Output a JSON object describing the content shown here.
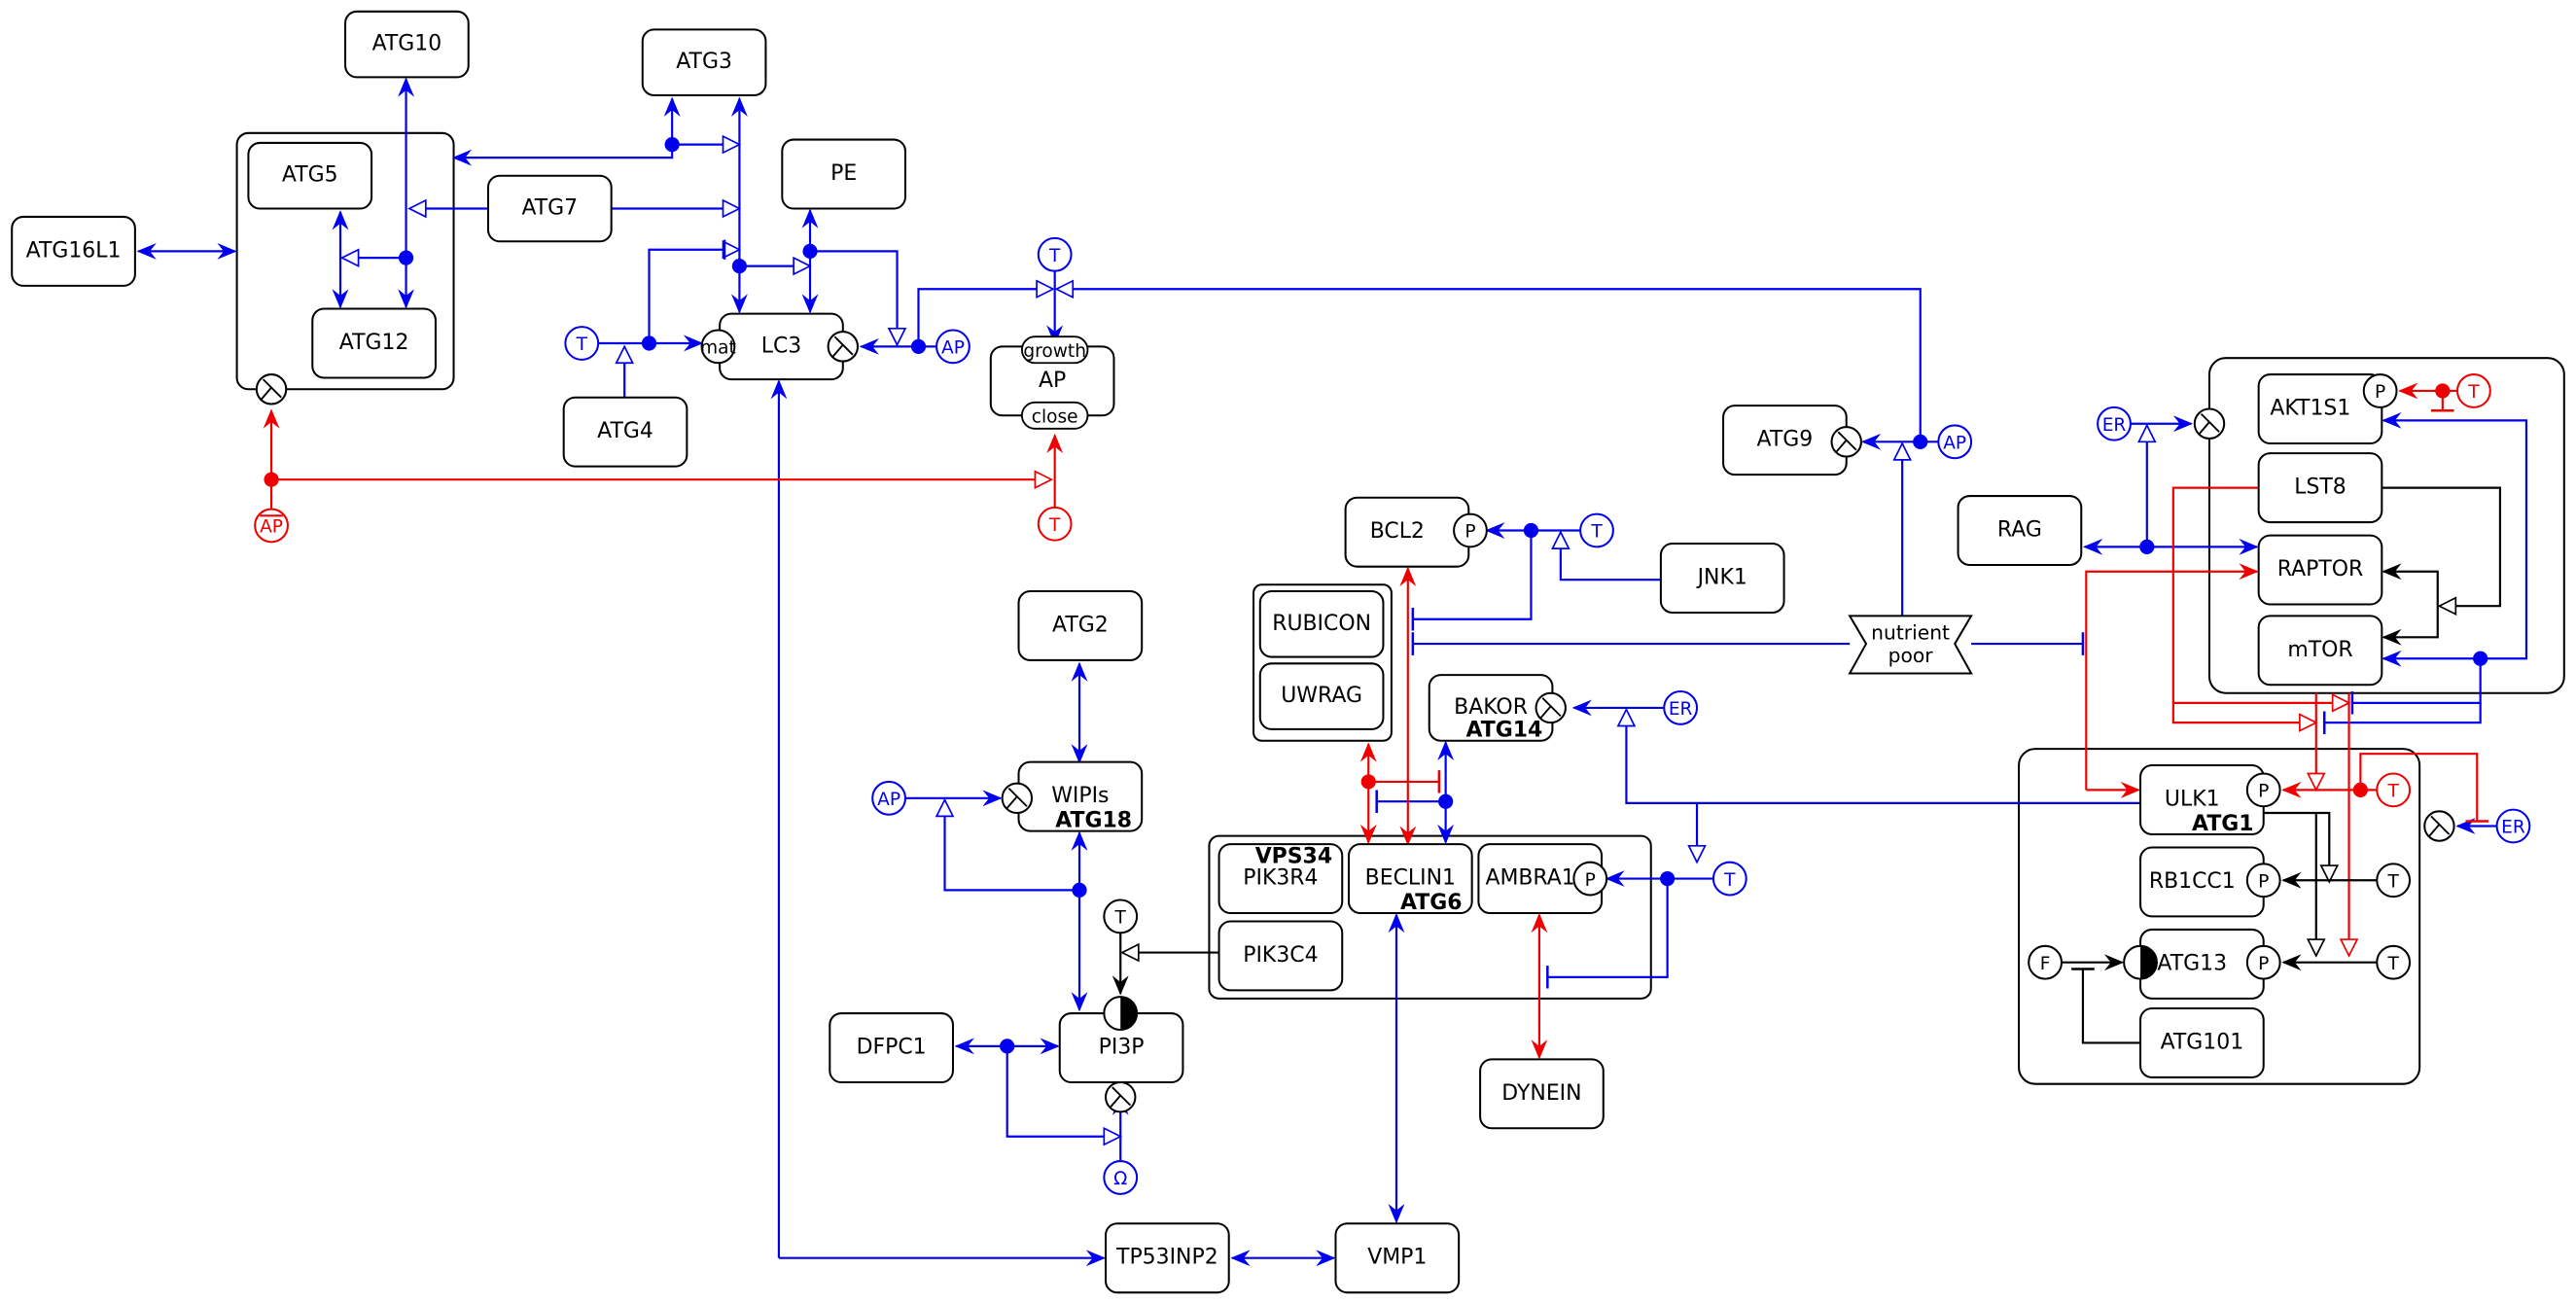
{
  "nodes": {
    "atg10": "ATG10",
    "atg3": "ATG3",
    "atg5": "ATG5",
    "atg12": "ATG12",
    "atg7": "ATG7",
    "atg16l1": "ATG16L1",
    "pe": "PE",
    "lc3": "LC3",
    "atg4": "ATG4",
    "ap": "AP",
    "atg9": "ATG9",
    "bcl2": "BCL2",
    "jnk1": "JNK1",
    "rubicon": "RUBICON",
    "uwrag": "UWRAG",
    "nutrient_poor_1": "nutrient",
    "nutrient_poor_2": "poor",
    "bakor": "BAKOR",
    "atg2": "ATG2",
    "wipis": "WIPIs",
    "pik3r4": "PIK3R4",
    "beclin1": "BECLIN1",
    "ambra1": "AMBRA1",
    "pik3c4": "PIK3C4",
    "pi3p": "PI3P",
    "dfpc1": "DFPC1",
    "dynein": "DYNEIN",
    "tp53inp2": "TP53INP2",
    "vmp1": "VMP1",
    "rag": "RAG",
    "akt1s1": "AKT1S1",
    "lst8": "LST8",
    "raptor": "RAPTOR",
    "mtor": "mTOR",
    "ulk1": "ULK1",
    "rb1cc1": "RB1CC1",
    "atg13": "ATG13",
    "atg101": "ATG101"
  },
  "aliases": {
    "bakor": "ATG14",
    "wipis": "ATG18",
    "pik3r4": "VPS34",
    "beclin1": "ATG6",
    "ulk1": "ATG1"
  },
  "states": {
    "mat": "mat",
    "growth": "growth",
    "close": "close",
    "p": "P"
  },
  "signals": {
    "t": "T",
    "ap": "AP",
    "er": "ER",
    "f": "F",
    "omega": "Ω"
  },
  "colors": {
    "activation": "#0000ee",
    "inhibition": "#ee0000",
    "neutral": "#000000",
    "alias": "#00dd00"
  }
}
